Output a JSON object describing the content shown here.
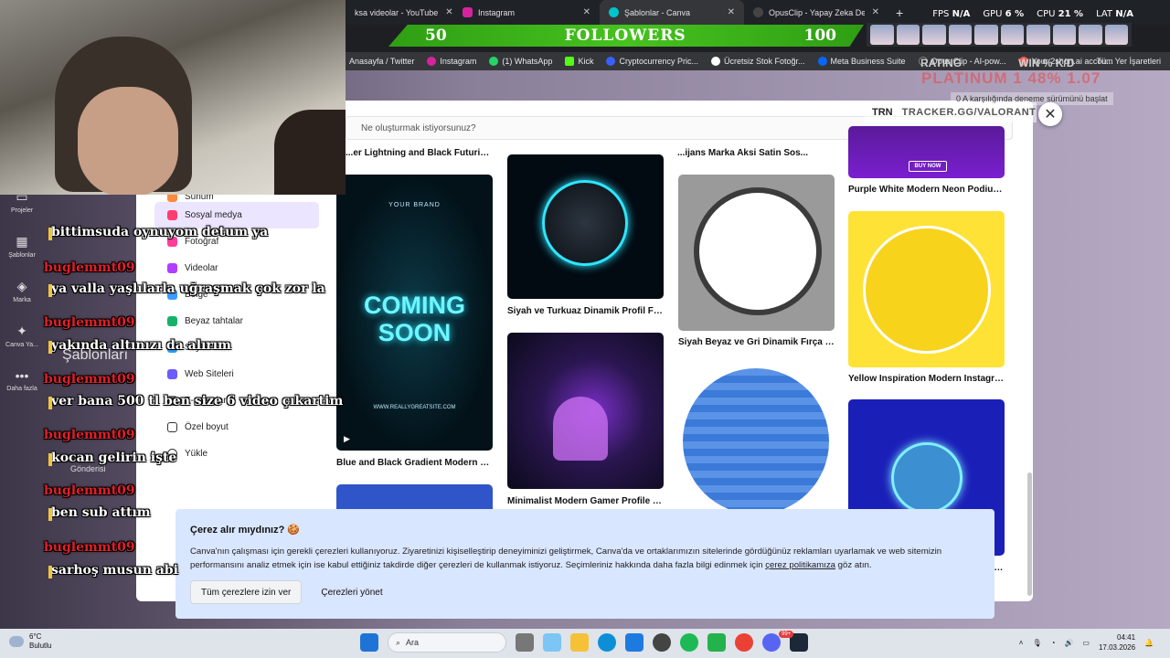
{
  "browser": {
    "tabs": [
      {
        "title": "ksa videolar - YouTube",
        "color": "#ff0000"
      },
      {
        "title": "Instagram",
        "color": "#d6249f"
      },
      {
        "title": "Şablonlar - Canva",
        "color": "#00c4cc"
      },
      {
        "title": "OpusClip - Yapay Zeka Destekli",
        "color": "#222222"
      }
    ],
    "new_tab": "+",
    "bookmarks": [
      {
        "label": "Anasayfa / Twitter",
        "color": "#111111"
      },
      {
        "label": "Instagram",
        "color": "#d6249f"
      },
      {
        "label": "(1) WhatsApp",
        "color": "#25d366"
      },
      {
        "label": "Kick",
        "color": "#53fc18"
      },
      {
        "label": "Cryptocurrency Pric...",
        "color": "#3861fb"
      },
      {
        "label": "Ücretsiz Stok Fotoğr...",
        "color": "#ffffff"
      },
      {
        "label": "Meta Business Suite",
        "color": "#0866ff"
      },
      {
        "label": "Opus Clip - AI-pow...",
        "color": "#222222"
      },
      {
        "label": "Your 2short.ai accou...",
        "color": "#ff5a5a"
      }
    ],
    "bookmarks_right": "Tüm Yer İşaretleri"
  },
  "overlay": {
    "fps_label": "FPS",
    "fps_value": "N/A",
    "gpu_label": "GPU",
    "gpu_value": "6 %",
    "cpu_label": "CPU",
    "cpu_value": "21 %",
    "lat_label": "LAT",
    "lat_value": "N/A",
    "followers_left": "50",
    "followers_title": "FOLLOWERS",
    "followers_right": "100",
    "rating_label": "RATING",
    "rating_extra": "WIN % K/D",
    "rank": "PLATINUM 1",
    "rank_value": "48% 1.07",
    "trn_logo": "TRN",
    "trn_url": "TRACKER.GG/VALORANT",
    "trial_text": "0 A karşılığında deneme sürümünü başlat"
  },
  "chat": [
    {
      "type": "msg",
      "text": "bittimsuda oynuyom detum ya"
    },
    {
      "type": "user",
      "text": "buglemmt09"
    },
    {
      "type": "msg",
      "text": "ya valla yaşlılarla uğraşmak çok zor la"
    },
    {
      "type": "user",
      "text": "buglemmt09"
    },
    {
      "type": "msg",
      "text": "yakında altınızı da alırım"
    },
    {
      "type": "user",
      "text": "buglemmt09"
    },
    {
      "type": "msg",
      "text": "ver bana 500 tl ben size 6 video çıkartim"
    },
    {
      "type": "user",
      "text": "buglemmt09"
    },
    {
      "type": "msg",
      "text": "kocan gelirin işte"
    },
    {
      "type": "user",
      "text": "buglemmt09"
    },
    {
      "type": "msg",
      "text": "ben sub attım"
    },
    {
      "type": "user",
      "text": "buglemmt09"
    },
    {
      "type": "msg",
      "text": "sarhoş musun abi"
    }
  ],
  "rail": [
    "Projeler",
    "Şablonlar",
    "Marka",
    "Canva Ya...",
    "Daha fazla",
    "Gönderisi"
  ],
  "canva": {
    "search_placeholder": "Ne oluşturmak istiyorsunuz?",
    "partial_heading": "Şablonları",
    "menu": [
      {
        "label": "Sunum",
        "color": "#ff8a3d"
      },
      {
        "label": "Sosyal medya",
        "color": "#ff3d6e",
        "selected": true
      },
      {
        "label": "Fotoğraf",
        "color": "#ff3d9a"
      },
      {
        "label": "Videolar",
        "color": "#b03dff"
      },
      {
        "label": "Belge",
        "color": "#3d9bff"
      },
      {
        "label": "Beyaz tahtalar",
        "color": "#17b26a"
      },
      {
        "label": "Sayfalar",
        "color": "#29a3ff"
      },
      {
        "label": "Web Siteleri",
        "color": "#6b5cff"
      },
      {
        "label": "E-postalar",
        "color": "#777777"
      },
      {
        "label": "Özel boyut",
        "color": "#333333"
      },
      {
        "label": "Yükle",
        "color": "#333333"
      }
    ],
    "top_partial_labels": [
      "...er Lightning and Black Futuristic...",
      "...ijans Marka Aksi Satin Sos...",
      "Purple White Modern Neon Podium ..."
    ],
    "cards": [
      {
        "label": "Blue and Black Gradient Modern Te...",
        "brand": "YOUR BRAND",
        "line1": "COMING",
        "line2": "SOON",
        "site": "WWW.REALLYGREATSITE.COM"
      },
      {
        "label": "Siyah ve Turkuaz Dinamik Profil Fot..."
      },
      {
        "label": "Minimalist Modern Gamer Profile Pi..."
      },
      {
        "label": "Siyah Beyaz ve Gri Dinamik Fırça Da..."
      },
      {
        "label": "Yellow Inspiration Modern Instagra..."
      },
      {
        "label": "...g..."
      }
    ],
    "buy_now": "BUY NOW"
  },
  "cookie": {
    "title": "Çerez alır mıydınız? 🍪",
    "text_before": "Canva'nın çalışması için gerekli çerezleri kullanıyoruz. Ziyaretinizi kişiselleştirip deneyiminizi geliştirmek, Canva'da ve ortaklarımızın sitelerinde gördüğünüz reklamları uyarlamak ve web sitemizin performansını analiz etmek için ise kabul ettiğiniz takdirde diğer çerezleri de kullanmak istiyoruz. Seçimleriniz hakkında daha fazla bilgi edinmek için ",
    "link": "çerez politikamıza",
    "text_after": " göz atın.",
    "accept": "Tüm çerezlere izin ver",
    "manage": "Çerezleri yönet"
  },
  "taskbar": {
    "temp": "6°C",
    "weather": "Bulutlu",
    "search": "Ara",
    "time": "04:41",
    "date": "17.03.2026",
    "notif_count": "99+"
  }
}
